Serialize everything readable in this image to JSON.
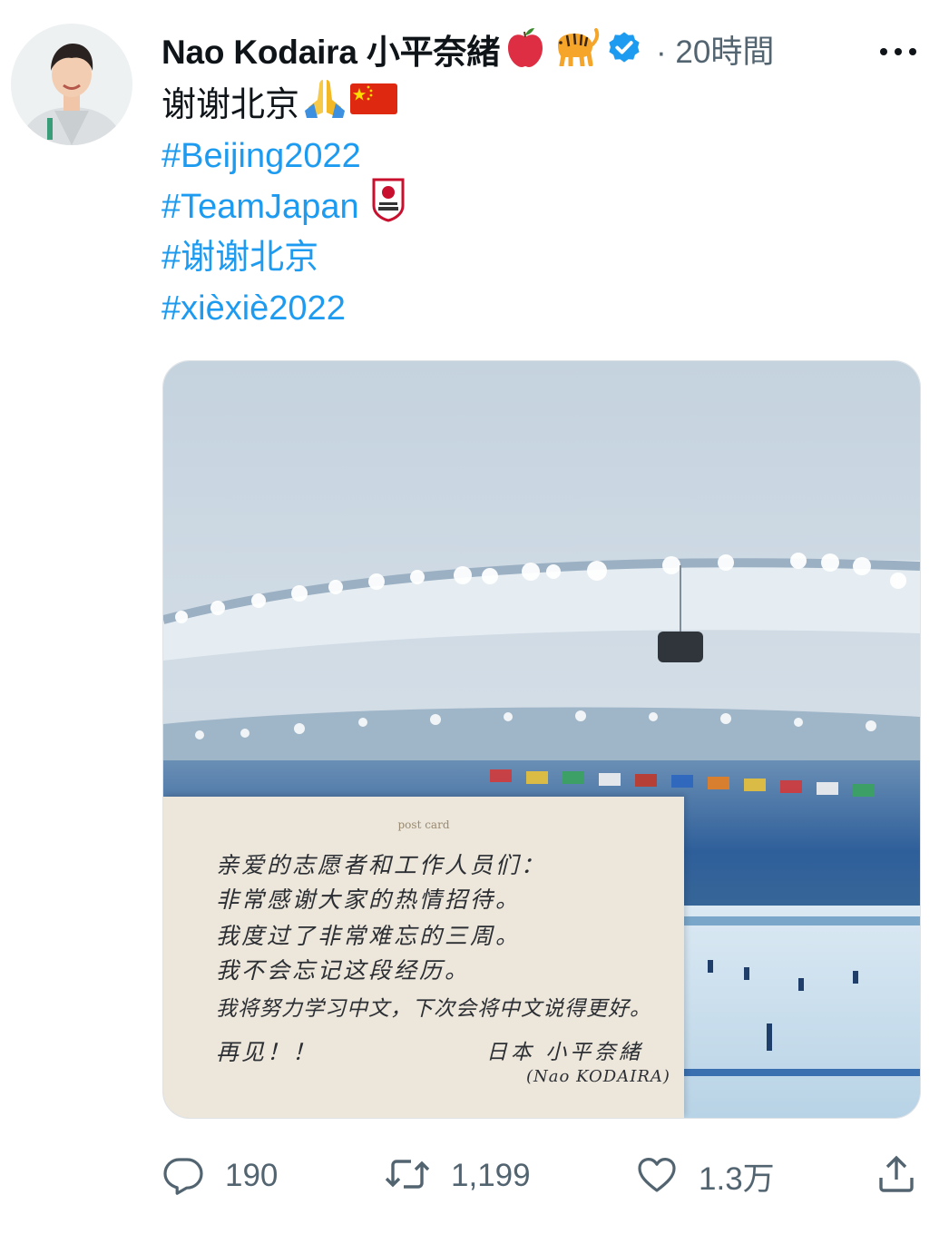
{
  "tweet": {
    "author_name": "Nao Kodaira 小平奈緒",
    "author_emojis": [
      "apple-icon",
      "tiger-icon"
    ],
    "verified": true,
    "separator": "·",
    "time": "20時間",
    "lines": [
      {
        "text": "谢谢北京",
        "emoji": "folded-hands-icon",
        "flag": "china-flag-icon"
      },
      {
        "text": "#Beijing2022"
      },
      {
        "text": "#TeamJapan",
        "badge": "team-japan-badge-icon"
      },
      {
        "text": "#谢谢北京"
      },
      {
        "text": "#xièxiè2022"
      }
    ]
  },
  "postcard": {
    "header": "post card",
    "lines": [
      "亲爱的志愿者和工作人员们：",
      "非常感谢大家的热情招待。",
      "我度过了非常难忘的三周。",
      "我不会忘记这段经历。",
      "我将努力学习中文，下次会将中文说得更好。",
      "再见！！"
    ],
    "signature": "日本 小平奈緒",
    "signature_romaji": "(Nao KODAIRA)"
  },
  "actions": {
    "reply_count": "190",
    "retweet_count": "1,199",
    "like_count": "1.3万"
  },
  "colors": {
    "accent": "#1d9bf0",
    "muted": "#536471",
    "text": "#0f1419"
  }
}
